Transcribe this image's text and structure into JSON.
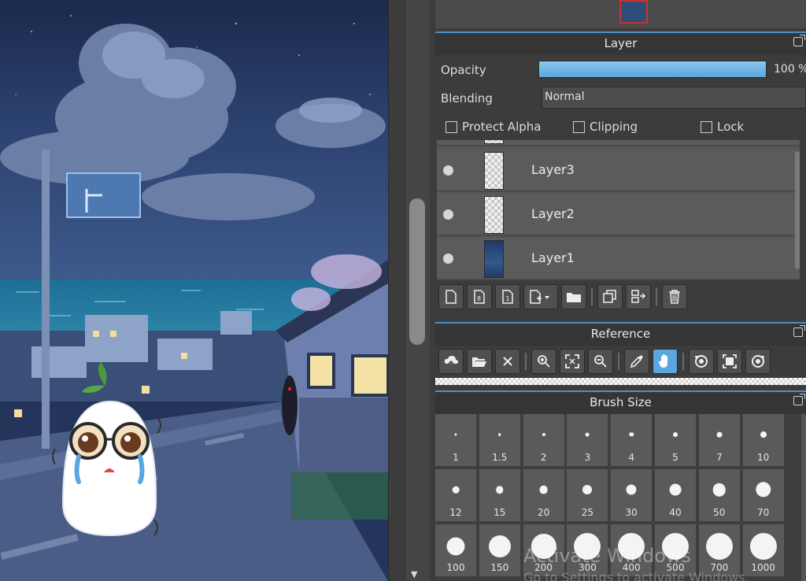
{
  "layer_panel": {
    "title": "Layer",
    "opacity_label": "Opacity",
    "opacity_value": "100 %",
    "opacity_fraction": 1.0,
    "blending_label": "Blending",
    "blending_value": "Normal",
    "checkboxes": [
      {
        "label": "Protect Alpha",
        "checked": false
      },
      {
        "label": "Clipping",
        "checked": false
      },
      {
        "label": "Lock",
        "checked": false
      }
    ],
    "layers": [
      {
        "name": "Layer3",
        "visible": true
      },
      {
        "name": "Layer2",
        "visible": true
      },
      {
        "name": "Layer1",
        "visible": true
      }
    ],
    "toolbar_icons": [
      "new-layer-icon",
      "new-8bit-layer-icon",
      "new-1bit-layer-icon",
      "add-layer-menu-icon",
      "folder-icon",
      "duplicate-layer-icon",
      "merge-down-icon",
      "delete-layer-icon"
    ]
  },
  "reference_panel": {
    "title": "Reference",
    "toolbar_icons": [
      "cloud-open-icon",
      "folder-open-icon",
      "close-icon",
      "zoom-in-icon",
      "fit-icon",
      "zoom-out-icon",
      "eyedropper-icon",
      "hand-icon",
      "rotate-left-icon",
      "actual-size-icon",
      "rotate-right-icon"
    ],
    "active_tool": "hand-icon"
  },
  "brush_size_panel": {
    "title": "Brush Size",
    "sizes": [
      "1",
      "1.5",
      "2",
      "3",
      "4",
      "5",
      "7",
      "10",
      "12",
      "15",
      "20",
      "25",
      "30",
      "40",
      "50",
      "70",
      "100",
      "150",
      "200",
      "300",
      "400",
      "500",
      "700",
      "1000"
    ]
  },
  "watermark": {
    "line1": "Activate Windows",
    "line2": "Go to Settings to activate Windows."
  },
  "colors": {
    "accent": "#5aa6e0",
    "panel_bg": "#3c3c3c",
    "header_line": "#4a8fc8"
  }
}
